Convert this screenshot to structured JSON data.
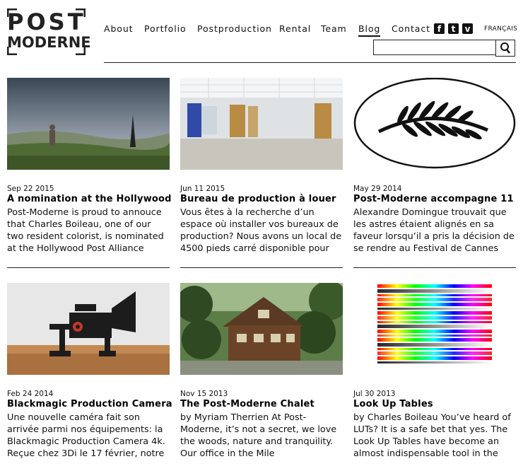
{
  "logo": {
    "line1": "POST",
    "line2": "MODERNE"
  },
  "nav": [
    {
      "label": "About"
    },
    {
      "label": "Portfolio"
    },
    {
      "label": "Postproduction"
    },
    {
      "label": "Rental"
    },
    {
      "label": "Team"
    },
    {
      "label": "Blog",
      "active": true
    },
    {
      "label": "Contact"
    }
  ],
  "social": [
    {
      "icon": "facebook-icon",
      "glyph": "f"
    },
    {
      "icon": "twitter-icon",
      "glyph": "t"
    },
    {
      "icon": "vimeo-icon",
      "glyph": "v"
    }
  ],
  "language_link": "FRANÇAIS",
  "search": {
    "value": "",
    "icon": "search-icon"
  },
  "posts": [
    {
      "date": "Sep 22 2015",
      "title": "A nomination at the Hollywood",
      "excerpt": "Post-Moderne is proud to annouce that Charles Boileau, one of our two resident colorist, is nominated at the Hollywood Post Alliance Awards",
      "image": "landscape-photo"
    },
    {
      "date": "Jun 11 2015",
      "title": "Bureau de production à louer",
      "excerpt": "Vous êtes à la recherche d’un espace où installer vos bureaux de production? Nous avons un local de 4500 pieds carré disponible pour",
      "image": "empty-office-photo"
    },
    {
      "date": "May 29 2014",
      "title": "Post-Moderne accompagne 11",
      "excerpt": "Alexandre Domingue trouvait que les astres étaient alignés en sa faveur lorsqu’il a pris la décision de se rendre au Festival de Cannes",
      "image": "palm-logo"
    },
    {
      "date": "Feb 24 2014",
      "title": "Blackmagic Production Camera",
      "excerpt": "Une nouvelle caméra fait son arrivée parmi nos équipements: la Blackmagic Production Camera 4k. Reçue chez 3Di le 17 février, notre",
      "image": "camera-rig-photo"
    },
    {
      "date": "Nov 15 2013",
      "title": "The Post-Moderne Chalet",
      "excerpt": "by Myriam Therrien At Post-Moderne, it’s not a secret, we love the woods, nature and tranquility. Our office in the Mile",
      "image": "chalet-photo"
    },
    {
      "date": "Jul 30 2013",
      "title": "Look Up Tables",
      "excerpt": "by Charles Boileau You’ve heard of LUTs? It is a safe bet that yes. The Look Up Tables have become an almost indispensable tool in the",
      "image": "lut-chart-image"
    }
  ],
  "colors": {
    "text": "#111111",
    "rule": "#222222",
    "background": "#ffffff"
  }
}
